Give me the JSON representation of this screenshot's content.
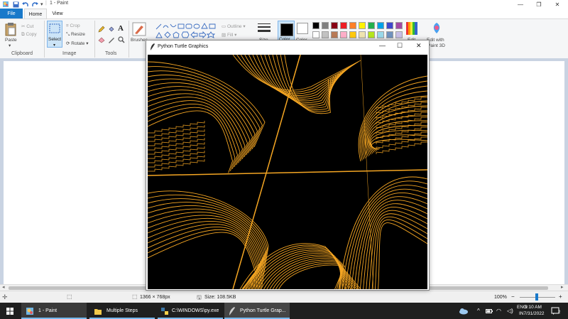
{
  "app": {
    "doc_title": "1 - Paint",
    "tabs": {
      "file": "File",
      "home": "Home",
      "view": "View"
    }
  },
  "ribbon": {
    "clipboard": {
      "paste": "Paste",
      "cut": "Cut",
      "copy": "Copy",
      "label": "Clipboard"
    },
    "image": {
      "select": "Select",
      "crop": "Crop",
      "resize": "Resize",
      "rotate": "Rotate",
      "label": "Image"
    },
    "tools": {
      "label": "Tools"
    },
    "brushes": "Brushes",
    "shapes": {
      "outline": "Outline",
      "fill": "Fill"
    },
    "size": "Size",
    "color1": "Color",
    "color2": "Color",
    "edit_colors": "Edit",
    "paint3d": {
      "line1": "Edit with",
      "line2": "Paint 3D"
    },
    "palette_row1": [
      "#000000",
      "#7f7f7f",
      "#880015",
      "#ed1c24",
      "#ff7f27",
      "#fff200",
      "#22b14c",
      "#00a2e8",
      "#3f48cc",
      "#a349a4"
    ],
    "palette_row2": [
      "#ffffff",
      "#c3c3c3",
      "#b97a57",
      "#ffaec9",
      "#ffc90e",
      "#efe4b0",
      "#b5e61d",
      "#99d9ea",
      "#7092be",
      "#c8bfe7"
    ]
  },
  "turtle_window": {
    "title": "Python Turtle Graphics",
    "line_color": "#f5a623"
  },
  "status": {
    "dimensions": "1366 × 768px",
    "size": "Size: 108.5KB",
    "zoom": "100%"
  },
  "taskbar": {
    "items": [
      "1 - Paint",
      "Multiple Steps",
      "C:\\WINDOWS\\py.exe",
      "Python Turtle Grap..."
    ],
    "lang1": "ENG",
    "lang2": "IN",
    "time": "9:10 AM",
    "date": "7/31/2022",
    "notif_count": "2"
  }
}
